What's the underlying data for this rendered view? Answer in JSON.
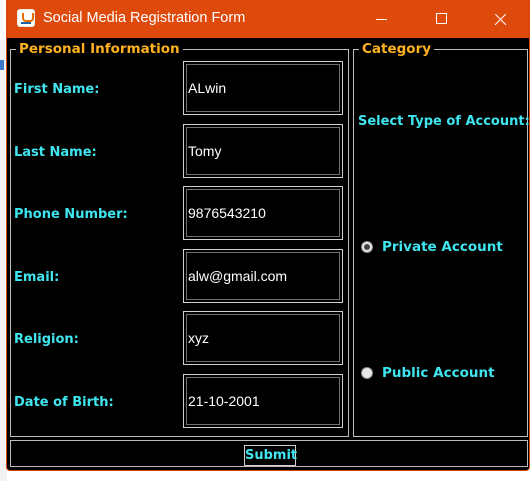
{
  "window": {
    "title": "Social Media Registration Form"
  },
  "personal_info": {
    "legend": "Personal Information",
    "fields": [
      {
        "label": "First Name:",
        "value": "ALwin"
      },
      {
        "label": "Last Name:",
        "value": "Tomy"
      },
      {
        "label": "Phone Number:",
        "value": "9876543210"
      },
      {
        "label": "Email:",
        "value": "alw@gmail.com"
      },
      {
        "label": "Religion:",
        "value": "xyz"
      },
      {
        "label": "Date of Birth:",
        "value": "21-10-2001"
      }
    ]
  },
  "category": {
    "legend": "Category",
    "prompt": "Select Type of Account:",
    "options": [
      {
        "label": "Private Account",
        "selected": true
      },
      {
        "label": "Public Account",
        "selected": false
      }
    ]
  },
  "submit_label": "Submit",
  "colors": {
    "titlebar": "#dd4a0c",
    "legend": "#ffb21f",
    "label": "#3fe6f0",
    "background": "#000000"
  }
}
